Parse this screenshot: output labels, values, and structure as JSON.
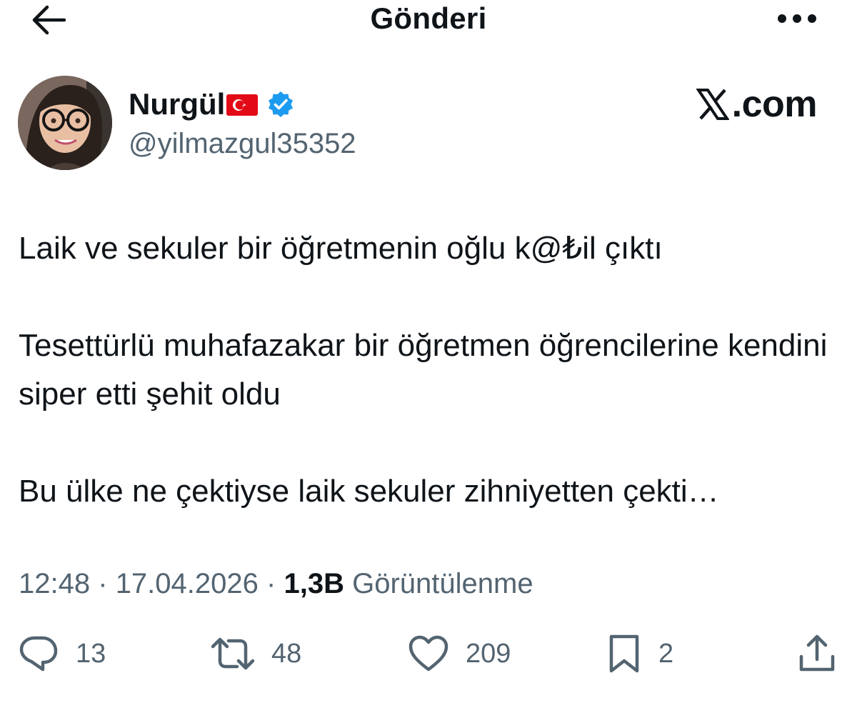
{
  "header": {
    "title": "Gönderi",
    "back_icon": "arrow-left-icon",
    "more_icon": "more-horizontal-icon"
  },
  "author": {
    "name": "Nurgül",
    "flag": "turkey-flag-emoji",
    "verified_icon": "verified-badge-icon",
    "verified_color": "#1d9bf0",
    "handle": "@yilmazgul35352"
  },
  "watermark": {
    "logo_icon": "x-logo-icon",
    "text": ".com"
  },
  "tweet": {
    "paragraphs": [
      "Laik ve sekuler bir öğretmenin oğlu k@₺il çıktı",
      "Tesettürlü muhafazakar bir öğretmen öğrencilerine kendini siper etti şehit oldu",
      "Bu ülke ne çektiyse laik sekuler zihniyetten çekti…"
    ]
  },
  "meta": {
    "time": "12:48",
    "separator": "·",
    "date": "17.04.2026",
    "views_count": "1,3B",
    "views_label": "Görüntülenme"
  },
  "actions": {
    "reply": {
      "icon": "reply-icon",
      "count": "13"
    },
    "repost": {
      "icon": "repost-icon",
      "count": "48"
    },
    "like": {
      "icon": "heart-icon",
      "count": "209"
    },
    "bookmark": {
      "icon": "bookmark-icon",
      "count": "2"
    },
    "share": {
      "icon": "share-icon"
    }
  },
  "colors": {
    "text_primary": "#0f1419",
    "text_secondary": "#536471",
    "accent": "#1d9bf0"
  }
}
